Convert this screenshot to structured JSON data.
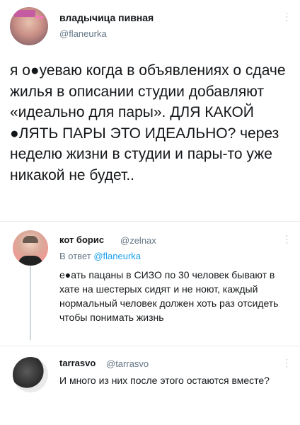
{
  "tweet": {
    "author_name": "владычица пивная",
    "author_handle": "@flaneurka",
    "text": "я о●уеваю когда в объявлениях о сдаче жилья в описании студии добавляют «идеально для пары». ДЛЯ КАКОЙ ●ЛЯТЬ ПАРЫ ЭТО ИДЕАЛЬНО? через неделю жизни в студии и пары-то уже никакой не будет.."
  },
  "replies": [
    {
      "author_name": "кот борис",
      "author_handle": "@zelnax",
      "reply_to_prefix": "В ответ",
      "reply_to_handle": "@flaneurka",
      "text": "е●ать пацаны в СИЗО по 30 человек бывают в хате на шестерых сидят и не ноют, каждый нормальный человек должен хоть раз отсидеть чтобы понимать жизнь"
    },
    {
      "author_name": "tarrasvo",
      "author_handle": "@tarrasvo",
      "text": "И много из них после этого остаются вместе?"
    }
  ],
  "icons": {
    "more": "more-vertical-icon"
  }
}
